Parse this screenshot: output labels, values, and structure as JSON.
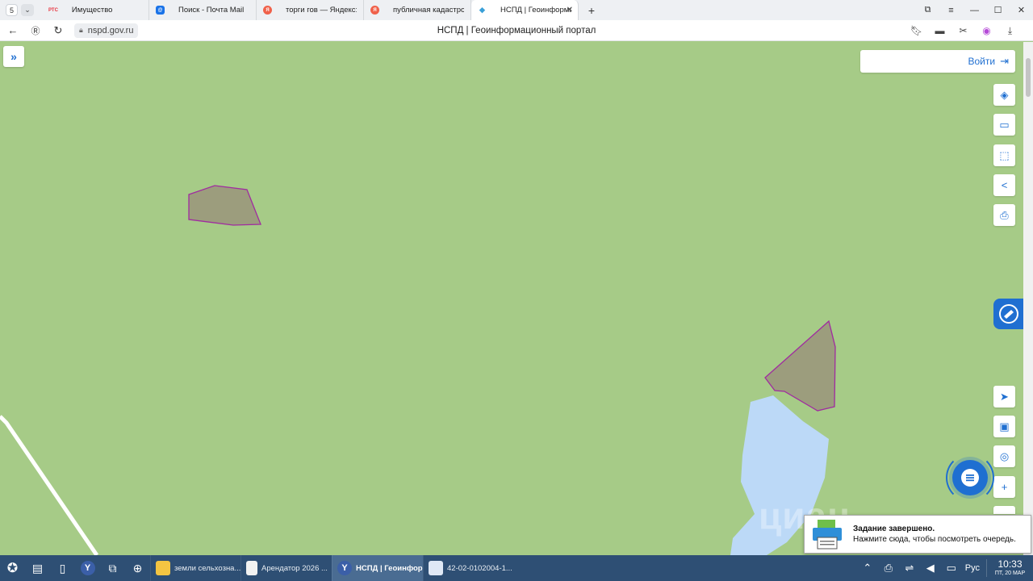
{
  "browser": {
    "tab_count": "5",
    "tabs": [
      {
        "label": "Имущество",
        "favicon": "РТС",
        "fav_color": "#e8313c"
      },
      {
        "label": "Поиск - Почта Mail",
        "favicon": "@",
        "fav_color": "#1a73e8"
      },
      {
        "label": "торги гов — Яндекс: нашлось",
        "favicon": "Я",
        "fav_color": "#f0614a"
      },
      {
        "label": "публичная кадастровая",
        "favicon": "Я",
        "fav_color": "#f0614a"
      },
      {
        "label": "НСПД | Геоинформационный",
        "favicon": "◆",
        "fav_color": "#3aa0d8",
        "close": "✕"
      }
    ],
    "url": "nspd.gov.ru",
    "page_title": "НСПД | Геоинформационный портал"
  },
  "map": {
    "login_label": "Войти",
    "watermark": "циан",
    "colors": {
      "land": "#a6cb87",
      "water": "#bcd9f7",
      "parcel_fill": "#9c9d7d",
      "parcel_stroke": "#a02ba0",
      "accent": "#1f6fd1"
    }
  },
  "notification": {
    "title": "Задание завершено.",
    "body": "Нажмите сюда, чтобы посмотреть очередь."
  },
  "taskbar": {
    "tasks": [
      {
        "label": "земли сельхозна...",
        "icon": "folder-icon"
      },
      {
        "label": "Арендатор 2026 ...",
        "icon": "document-icon"
      },
      {
        "label": "НСПД | Геоинфор...",
        "icon": "yandex-browser-icon",
        "active": true
      },
      {
        "label": "42-02-0102004-1...",
        "icon": "image-viewer-icon"
      }
    ],
    "language": "Рус",
    "time": "10:33",
    "date": "ПТ, 20 МАР"
  }
}
